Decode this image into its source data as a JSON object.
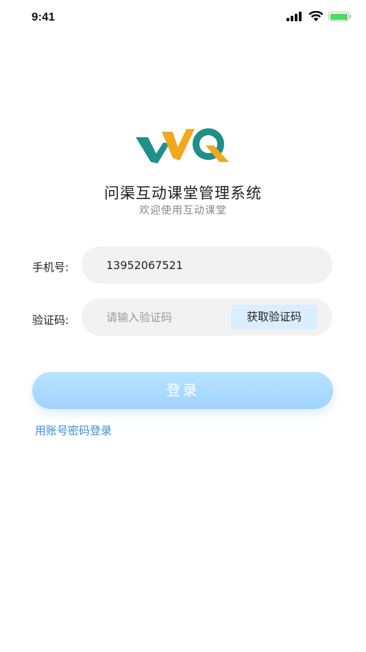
{
  "status_bar": {
    "time": "9:41",
    "icons": [
      "signal-icon",
      "wifi-icon",
      "battery-icon"
    ],
    "battery_level": 1.0,
    "battery_color": "#4cd964"
  },
  "brand": {
    "logo_text": "WQ",
    "logo_colors": {
      "teal": "#1f8f8c",
      "gold": "#f2a81d"
    },
    "title": "问渠互动课堂管理系统",
    "subtitle": "欢迎使用互动课堂"
  },
  "form": {
    "phone": {
      "label": "手机号:",
      "value": "13952067521"
    },
    "code": {
      "label": "验证码:",
      "placeholder": "请输入验证码",
      "value": "",
      "get_code_label": "获取验证码"
    }
  },
  "actions": {
    "login_label": "登录",
    "account_login_label": "用账号密码登录"
  },
  "colors": {
    "login_button": "#a8daff",
    "link": "#3a8fd9",
    "field_bg": "#f2f2f2",
    "get_code_bg": "#dbeeff"
  }
}
